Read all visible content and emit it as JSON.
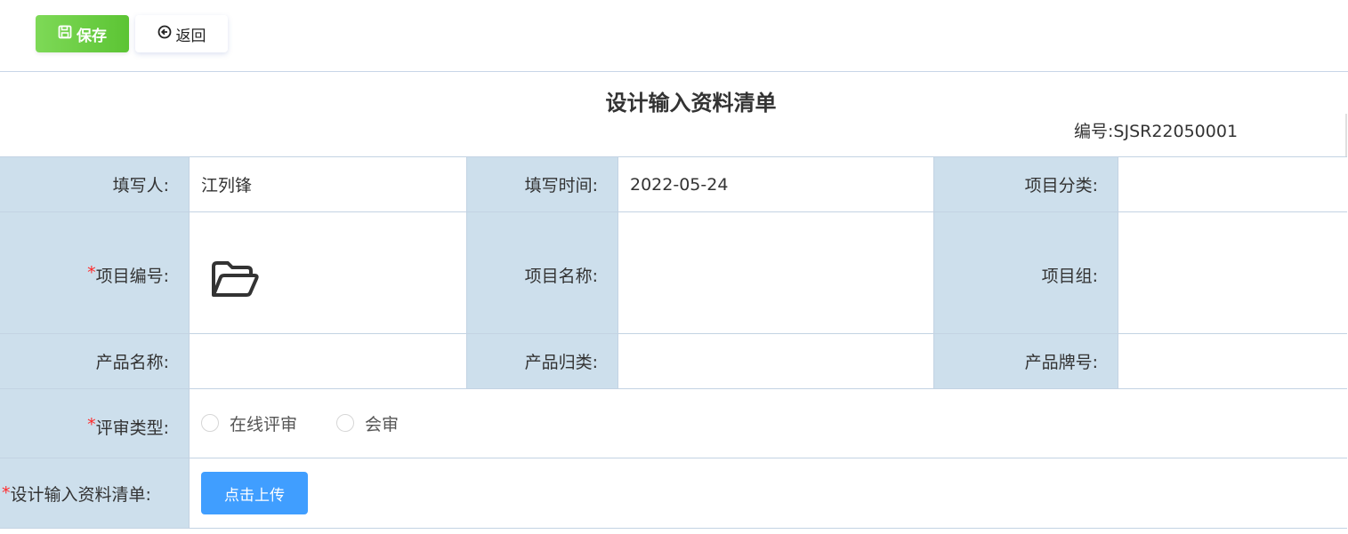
{
  "toolbar": {
    "save_label": "保存",
    "back_label": "返回"
  },
  "form": {
    "title": "设计输入资料清单",
    "serial_label": "编号:",
    "serial_value": "SJSR22050001",
    "required_mark": "*",
    "row1": {
      "filler_label": "填写人:",
      "filler_value": "江列锋",
      "time_label": "填写时间:",
      "time_value": "2022-05-24",
      "category_label": "项目分类:",
      "category_value": ""
    },
    "row2": {
      "project_no_label": "项目编号:",
      "project_name_label": "项目名称:",
      "project_name_value": "",
      "project_group_label": "项目组:",
      "project_group_value": ""
    },
    "row3": {
      "product_name_label": "产品名称:",
      "product_name_value": "",
      "product_class_label": "产品归类:",
      "product_class_value": "",
      "product_brand_label": "产品牌号:",
      "product_brand_value": ""
    },
    "row4": {
      "review_type_label": "评审类型:",
      "options": [
        "在线评审",
        "会审"
      ]
    },
    "row5": {
      "material_label": "设计输入资料清单:",
      "upload_label": "点击上传"
    }
  },
  "icons": {
    "save": "save-icon",
    "back": "back-circle-icon",
    "folder": "folder-open-icon"
  }
}
